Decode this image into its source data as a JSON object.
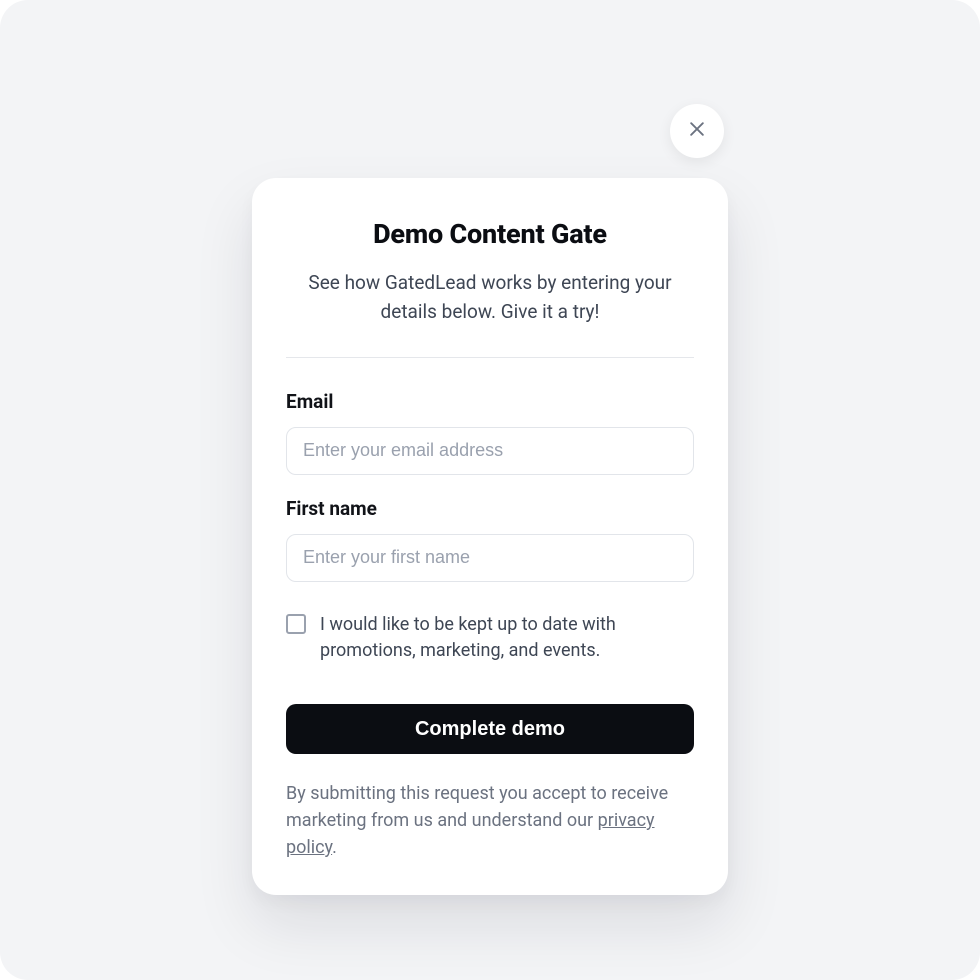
{
  "modal": {
    "title": "Demo Content Gate",
    "subtitle": "See how GatedLead works by entering your details below. Give it a try!",
    "fields": {
      "email": {
        "label": "Email",
        "placeholder": "Enter your email address",
        "value": ""
      },
      "first_name": {
        "label": "First name",
        "placeholder": "Enter your first name",
        "value": ""
      }
    },
    "checkbox": {
      "label": "I would like to be kept up to date with promotions, marketing, and events.",
      "checked": false
    },
    "submit_label": "Complete demo",
    "disclaimer": {
      "prefix": "By submitting this request you accept to receive marketing from us and understand our ",
      "link_text": "privacy policy",
      "suffix": "."
    }
  }
}
